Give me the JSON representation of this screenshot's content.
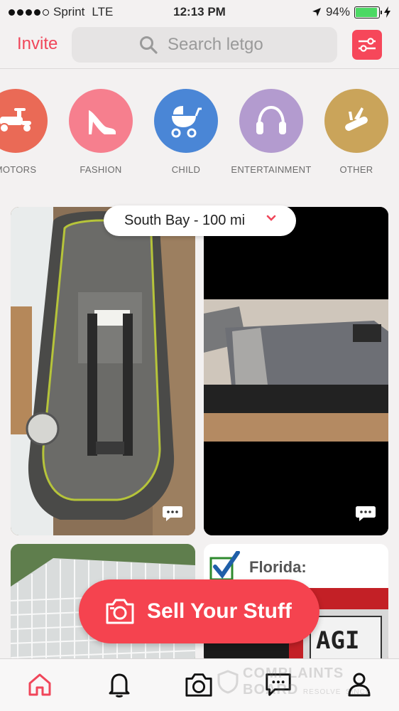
{
  "status_bar": {
    "carrier": "Sprint",
    "network": "LTE",
    "time": "12:13 PM",
    "battery_percent": "94%",
    "battery_level": 0.94,
    "signal_bars": 4
  },
  "header": {
    "invite_label": "Invite",
    "search_placeholder": "Search letgo"
  },
  "categories": [
    {
      "label": "MOTORS",
      "color": "#ea6a56",
      "icon": "scooter-icon"
    },
    {
      "label": "FASHION",
      "color": "#f67f8e",
      "icon": "high-heel-icon"
    },
    {
      "label": "CHILD",
      "color": "#4a86d6",
      "icon": "stroller-icon"
    },
    {
      "label": "ENTERTAINMENT",
      "color": "#b39bcf",
      "icon": "headphones-icon"
    },
    {
      "label": "OTHER",
      "color": "#caa45a",
      "icon": "swiss-knife-icon"
    }
  ],
  "location_filter": {
    "label": "South Bay - 100 mi"
  },
  "listings": [
    {
      "title": "",
      "icon": "car-seat-photo"
    },
    {
      "title": "",
      "icon": "bed-photo"
    },
    {
      "title": "",
      "icon": "wire-rack-photo"
    },
    {
      "title": "Florida:",
      "icon": "license-plate-photo",
      "plate_text": "AGI"
    }
  ],
  "sell_button": {
    "label": "Sell Your Stuff"
  },
  "watermark": {
    "line1": "COMPLAINTS",
    "line2": "BOARD",
    "line3": "RESOLVE",
    "line4": "SINCE"
  },
  "colors": {
    "accent": "#f6475a",
    "sell": "#f5434f"
  }
}
